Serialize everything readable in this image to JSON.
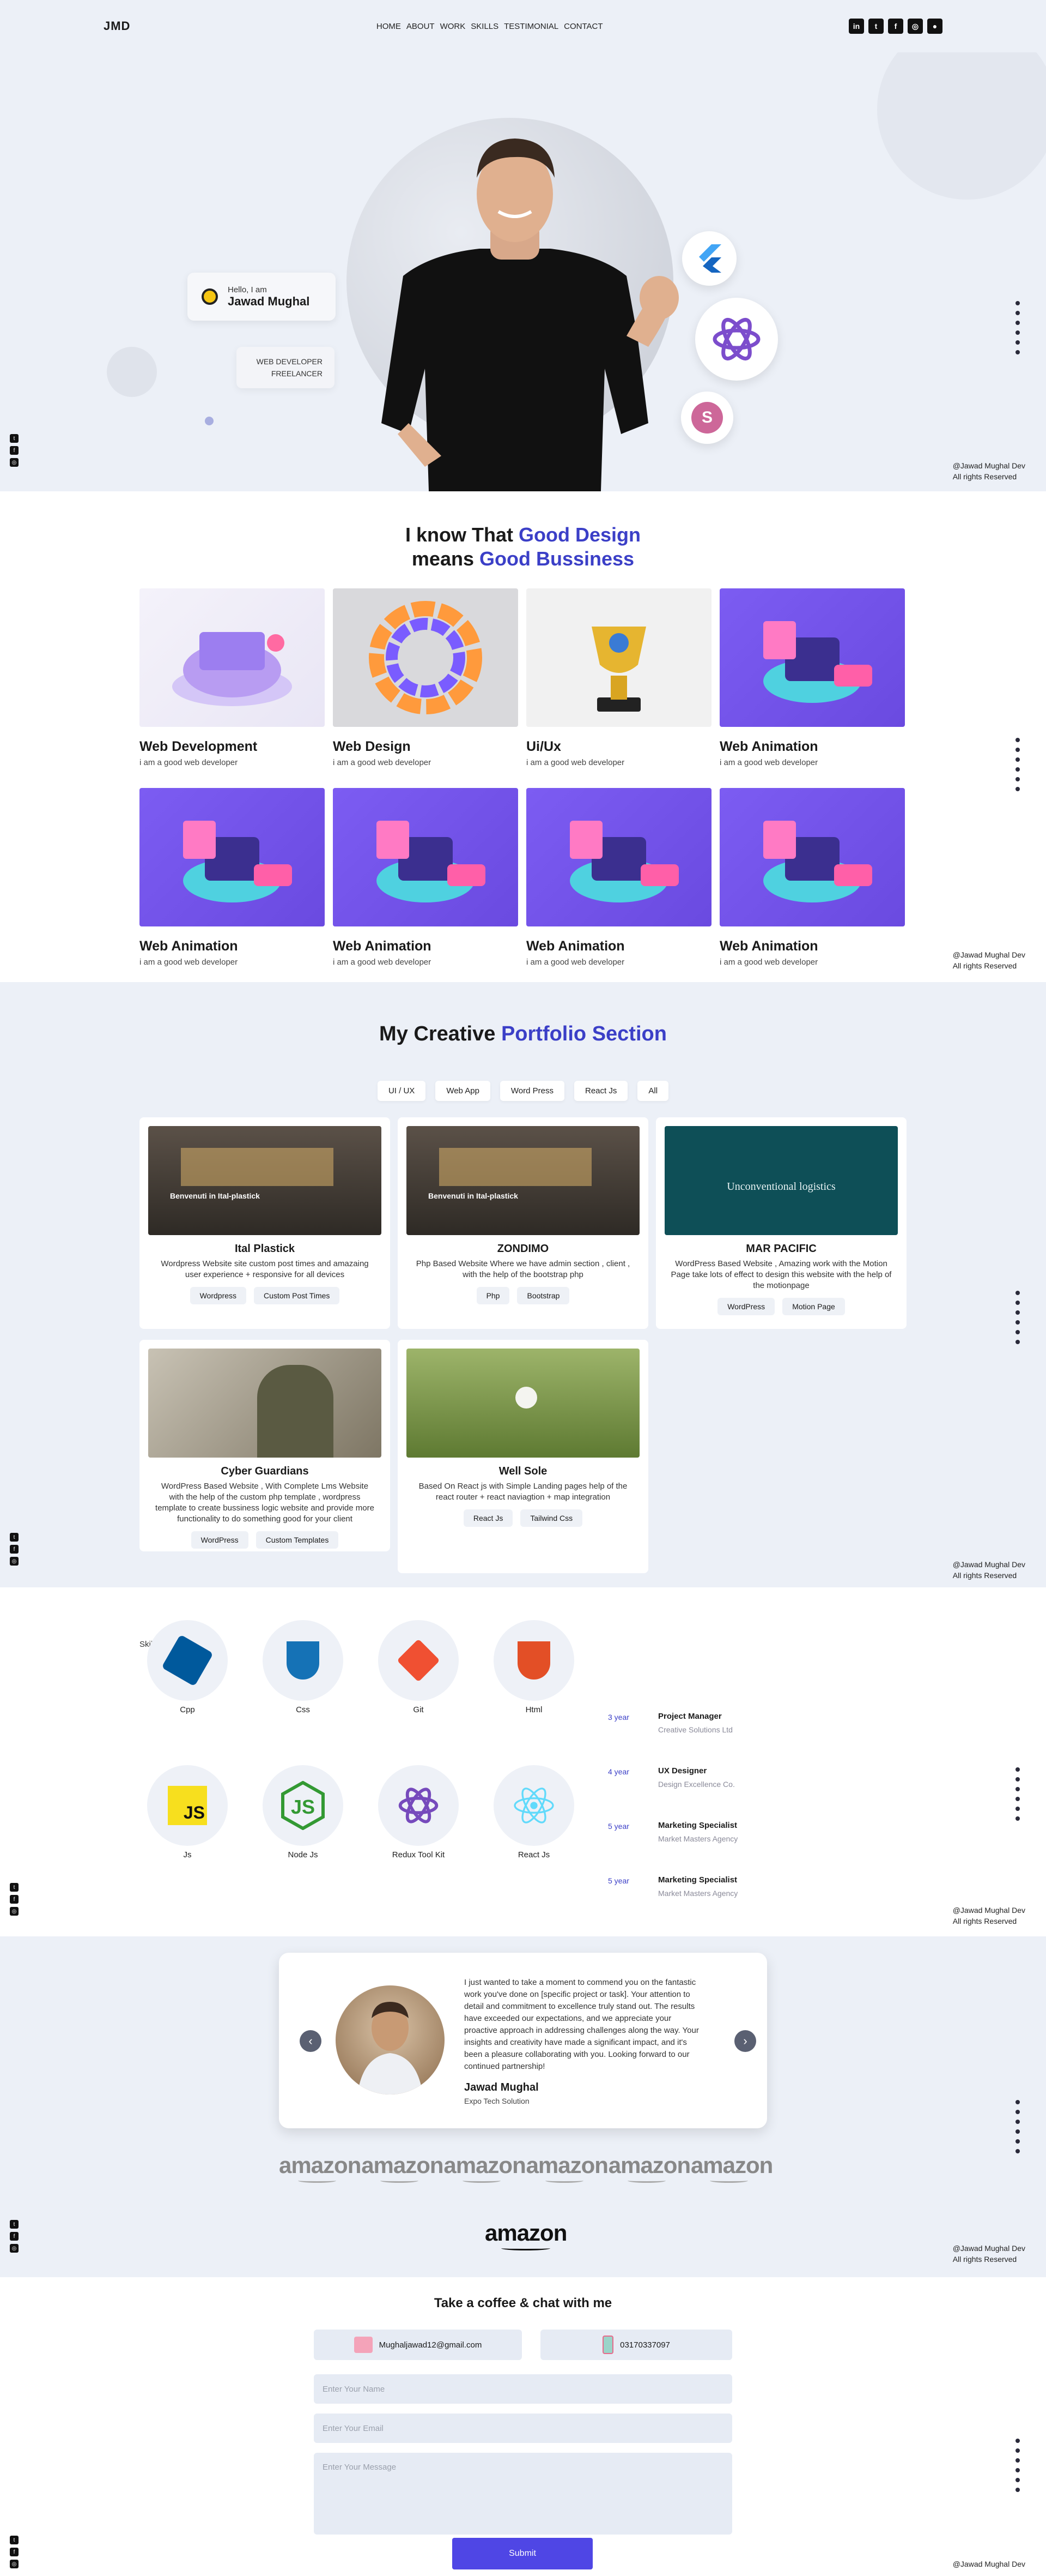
{
  "header": {
    "logo": "JMD",
    "nav": [
      "HOME",
      "ABOUT",
      "WORK",
      "SKILLS",
      "TESTIMONIAL",
      "CONTACT"
    ],
    "socials": [
      "linkedin-icon",
      "twitter-icon",
      "facebook-icon",
      "instagram-icon",
      "github-icon"
    ]
  },
  "hero": {
    "hello": "Hello, I am",
    "name": "Jawad Mughal",
    "role_line1": "WEB DEVELOPER",
    "role_line2": "FREELANCER",
    "tech": [
      "flutter-icon",
      "redux-icon",
      "sass-icon"
    ]
  },
  "footer_note": {
    "line1": "@Jawad Mughal Dev",
    "line2": "All rights Reserved"
  },
  "services": {
    "title_a": "I know That ",
    "title_b": "Good Design",
    "title_c": "means ",
    "title_d": "Good Bussiness",
    "items": [
      {
        "name": "Web Development",
        "desc": "i am a good web developer"
      },
      {
        "name": "Web Design",
        "desc": "i am a good web developer"
      },
      {
        "name": "Ui/Ux",
        "desc": "i am a good web developer"
      },
      {
        "name": "Web Animation",
        "desc": "i am a good web developer"
      },
      {
        "name": "Web Animation",
        "desc": "i am a good web developer"
      },
      {
        "name": "Web Animation",
        "desc": "i am a good web developer"
      },
      {
        "name": "Web Animation",
        "desc": "i am a good web developer"
      },
      {
        "name": "Web Animation",
        "desc": "i am a good web developer"
      }
    ]
  },
  "portfolio": {
    "title_a": "My Creative ",
    "title_b": "Portfolio Section",
    "filters": [
      "UI / UX",
      "Web App",
      "Word Press",
      "React Js",
      "All"
    ],
    "projects": [
      {
        "name": "Ital Plastick",
        "desc": "Wordpress Website site custom post times and amazaing user experience + responsive for all devices",
        "tags": [
          "Wordpress",
          "Custom Post Times"
        ],
        "banner": "Benvenuti in Ital-plastick"
      },
      {
        "name": "ZONDIMO",
        "desc": "Php Based Website Where we have admin section , client , with the help of the bootstrap php",
        "tags": [
          "Php",
          "Bootstrap"
        ],
        "banner": "Benvenuti in Ital-plastick"
      },
      {
        "name": "MAR PACIFIC",
        "desc": "WordPress Based Website , Amazing work with the Motion Page take lots of effect to design this website with the help of the motionpage",
        "tags": [
          "WordPress",
          "Motion Page"
        ],
        "banner": "Unconventional logistics"
      },
      {
        "name": "Cyber Guardians",
        "desc": "WordPress Based Website , With Complete Lms Website with the help of the custom php template , wordpress template to create bussiness logic website and provide more functionality to do something good for your client",
        "tags": [
          "WordPress",
          "Custom Templates"
        ],
        "banner": ""
      },
      {
        "name": "Well Sole",
        "desc": "Based On React js with Simple Landing pages help of the react router + react naviagtion + map integration",
        "tags": [
          "React Js",
          "Tailwind Css"
        ],
        "banner": ""
      }
    ]
  },
  "skills": {
    "label": "Skills & Experience",
    "items": [
      {
        "name": "Cpp"
      },
      {
        "name": "Css"
      },
      {
        "name": "Git"
      },
      {
        "name": "Html"
      },
      {
        "name": "Js"
      },
      {
        "name": "Node Js"
      },
      {
        "name": "Redux Tool Kit"
      },
      {
        "name": "React Js"
      }
    ],
    "experience": [
      {
        "year": "3 year",
        "title": "Project Manager",
        "company": "Creative Solutions Ltd"
      },
      {
        "year": "4 year",
        "title": "UX Designer",
        "company": "Design Excellence Co."
      },
      {
        "year": "5 year",
        "title": "Marketing Specialist",
        "company": "Market Masters Agency"
      },
      {
        "year": "5 year",
        "title": "Marketing Specialist",
        "company": "Market Masters Agency"
      }
    ]
  },
  "testimonial": {
    "text": "I just wanted to take a moment to commend you on the fantastic work you've done on [specific project or task]. Your attention to detail and commitment to excellence truly stand out. The results have exceeded our expectations, and we appreciate your proactive approach in addressing challenges along the way. Your insights and creativity have made a significant impact, and it's been a pleasure collaborating with you. Looking forward to our continued partnership!",
    "name": "Jawad Mughal",
    "company": "Expo Tech Solution",
    "brands": [
      "amazon",
      "amazon",
      "amazon",
      "amazon",
      "amazon",
      "amazon"
    ],
    "brand_main": "amazon"
  },
  "contact": {
    "title": "Take a coffee & chat with me",
    "email": "Mughaljawad12@gmail.com",
    "phone": "03170337097",
    "name_placeholder": "Enter Your Name",
    "email_placeholder": "Enter Your Email",
    "message_placeholder": "Enter Your Message",
    "submit": "Submit"
  },
  "colors": {
    "accent": "#3b3fc7",
    "soft_bg": "#ecf0f7",
    "button": "#4f46e5"
  }
}
